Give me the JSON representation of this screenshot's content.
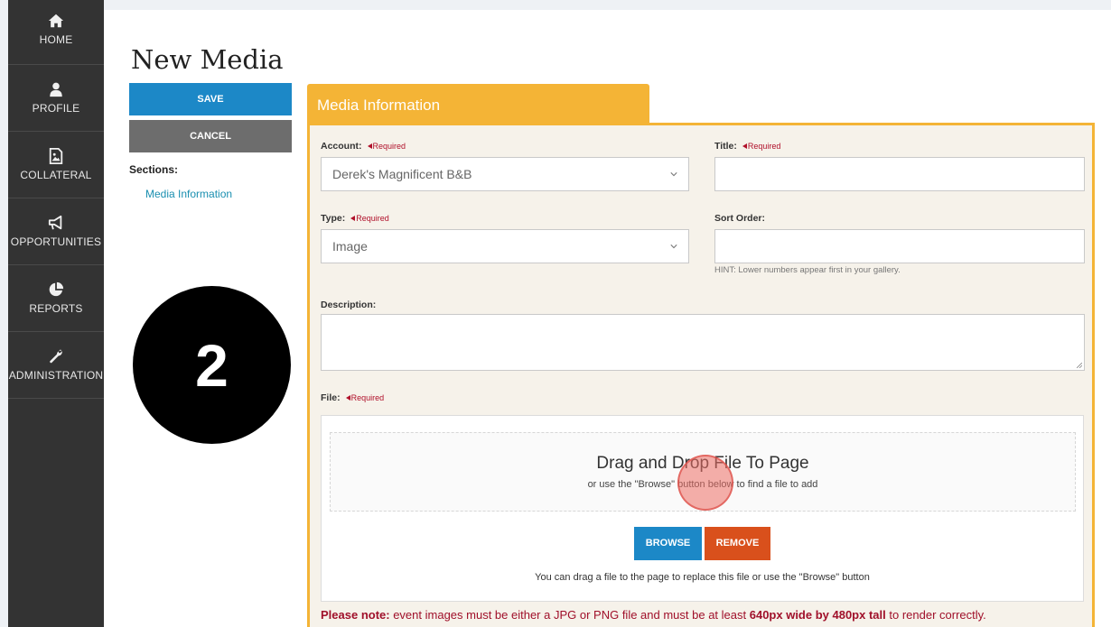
{
  "nav": {
    "items": [
      {
        "label": "HOME",
        "icon": "home-icon"
      },
      {
        "label": "PROFILE",
        "icon": "user-icon"
      },
      {
        "label": "COLLATERAL",
        "icon": "image-file-icon"
      },
      {
        "label": "OPPORTUNITIES",
        "icon": "megaphone-icon"
      },
      {
        "label": "REPORTS",
        "icon": "pie-chart-icon"
      },
      {
        "label": "ADMINISTRATION",
        "icon": "wrench-icon"
      }
    ]
  },
  "page": {
    "title": "New Media",
    "save_label": "SAVE",
    "cancel_label": "CANCEL",
    "sections_label": "Sections:",
    "sections_link": "Media Information"
  },
  "step_badge": "2",
  "panel": {
    "tab_label": "Media Information",
    "required_text": "Required",
    "account": {
      "label": "Account:",
      "value": "Derek's Magnificent B&B"
    },
    "title": {
      "label": "Title:",
      "value": ""
    },
    "type": {
      "label": "Type:",
      "value": "Image"
    },
    "sort_order": {
      "label": "Sort Order:",
      "value": "",
      "hint": "HINT: Lower numbers appear first in your gallery."
    },
    "description": {
      "label": "Description:",
      "value": ""
    },
    "file": {
      "label": "File:",
      "drop_title": "Drag and Drop File To Page",
      "drop_sub": "or use the \"Browse\" button below to find a file to add",
      "browse_label": "BROWSE",
      "remove_label": "REMOVE",
      "replace_note": "You can drag a file to the page to replace this file or use the \"Browse\" button"
    },
    "note": {
      "prefix": "Please note:",
      "text1": " event images must be either a JPG or PNG file and must be at least ",
      "dims": "640px wide by 480px tall",
      "text2": " to render correctly."
    }
  },
  "colors": {
    "nav_bg": "#333333",
    "accent_blue": "#1c88c7",
    "accent_orange": "#f4b436",
    "remove_orange": "#d9501c",
    "required_red": "#b0102a"
  }
}
